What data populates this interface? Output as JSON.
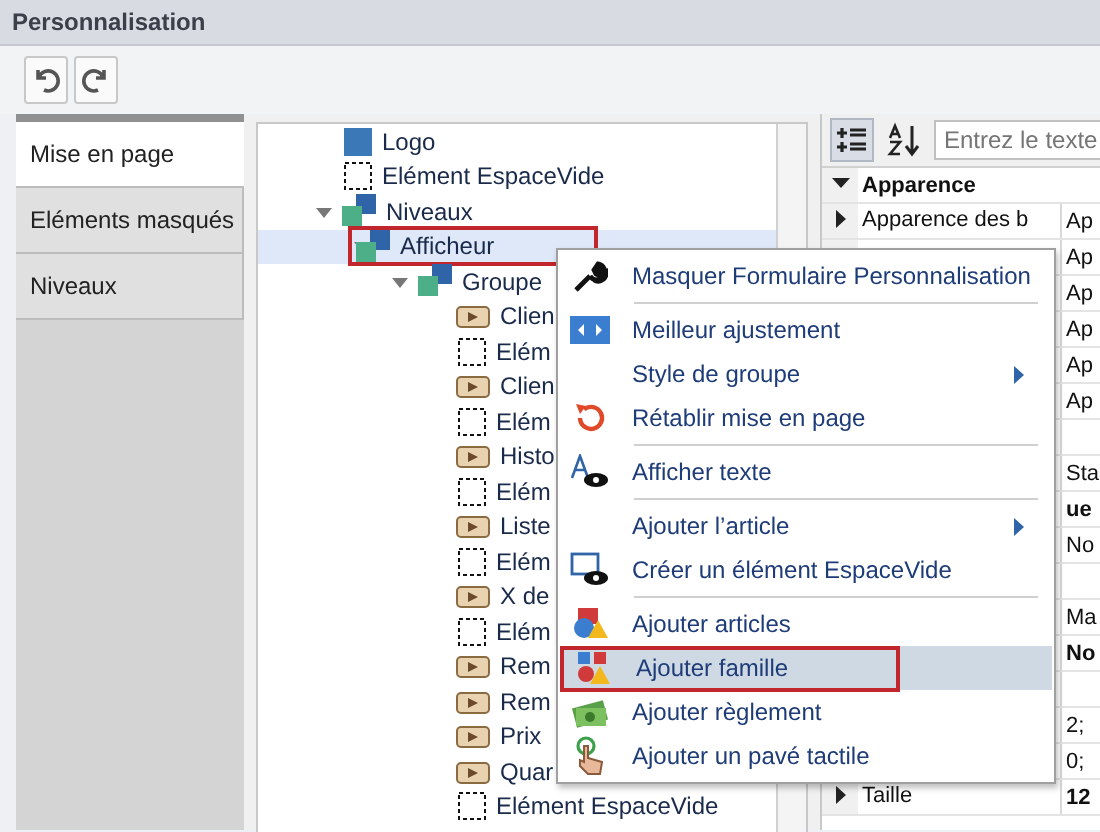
{
  "window": {
    "title": "Personnalisation"
  },
  "toolbar": {
    "buttons": [
      {
        "kind": "undo",
        "disabled": false
      },
      {
        "kind": "redo",
        "disabled": false
      }
    ]
  },
  "tabs": [
    {
      "label": "Mise en page",
      "selected": true
    },
    {
      "label": "Eléments masqués",
      "selected": false
    },
    {
      "label": "Niveaux",
      "selected": false
    }
  ],
  "tree": [
    {
      "kind": "block",
      "label": "Logo"
    },
    {
      "kind": "space",
      "label": "Elément EspaceVide"
    },
    {
      "kind": "level",
      "label": "Niveaux",
      "expanded": true,
      "children": [
        {
          "kind": "level",
          "label": "Afficheur",
          "expanded": true,
          "selected": true,
          "outlined": true,
          "children": [
            {
              "kind": "level",
              "label": "Groupe",
              "expanded": true,
              "children": [
                {
                  "kind": "item",
                  "label": "Clien"
                },
                {
                  "kind": "space",
                  "label": "Elém"
                },
                {
                  "kind": "item",
                  "label": "Clien"
                },
                {
                  "kind": "space",
                  "label": "Elém"
                },
                {
                  "kind": "item",
                  "label": "Histo"
                },
                {
                  "kind": "space",
                  "label": "Elém"
                },
                {
                  "kind": "item",
                  "label": "Liste"
                },
                {
                  "kind": "space",
                  "label": "Elém"
                },
                {
                  "kind": "item",
                  "label": "X de"
                },
                {
                  "kind": "space",
                  "label": "Elém"
                },
                {
                  "kind": "item",
                  "label": "Rem"
                },
                {
                  "kind": "item",
                  "label": "Rem"
                },
                {
                  "kind": "item",
                  "label": "Prix"
                },
                {
                  "kind": "item",
                  "label": "Quar"
                },
                {
                  "kind": "space",
                  "label": "Elément EspaceVide"
                }
              ]
            }
          ]
        }
      ]
    }
  ],
  "property_grid": {
    "search_placeholder": "Entrez le texte",
    "rows": [
      {
        "kind": "category",
        "name": "Apparence",
        "expanded": true
      },
      {
        "kind": "property",
        "name": "Apparence des b",
        "value": "Ap",
        "expanded": false
      },
      {
        "kind": "property",
        "value": "Ap"
      },
      {
        "kind": "property",
        "value": "Ap"
      },
      {
        "kind": "property",
        "value": "Ap"
      },
      {
        "kind": "property",
        "value": "Ap"
      },
      {
        "kind": "property",
        "value": "Ap"
      },
      {
        "kind": "blank"
      },
      {
        "kind": "property",
        "value": "Sta"
      },
      {
        "kind": "property",
        "value": "ue",
        "bold": true
      },
      {
        "kind": "property",
        "value": "No"
      },
      {
        "kind": "blank"
      },
      {
        "kind": "property",
        "value": "Ma"
      },
      {
        "kind": "property",
        "value": "No",
        "bold": true
      },
      {
        "kind": "blank"
      },
      {
        "kind": "property",
        "value": "2;"
      },
      {
        "kind": "property",
        "value": "0;"
      },
      {
        "kind": "property",
        "name": "Taille",
        "value": "12",
        "bold": true,
        "expanded": false
      }
    ]
  },
  "context_menu": {
    "items": [
      {
        "label": "Masquer Formulaire Personnalisation",
        "selected": false,
        "separator_after": true
      },
      {
        "label": "Meilleur ajustement",
        "selected": false
      },
      {
        "label": "Style de groupe",
        "selected": false,
        "submenu": true
      },
      {
        "label": "Rétablir mise en page",
        "selected": false,
        "separator_after": true
      },
      {
        "label": "Afficher texte",
        "selected": false,
        "separator_after": true
      },
      {
        "label": "Ajouter l’article",
        "selected": false,
        "submenu": true
      },
      {
        "label": "Créer un élément EspaceVide",
        "selected": false,
        "separator_after": true
      },
      {
        "label": "Ajouter articles",
        "selected": false
      },
      {
        "label": "Ajouter famille",
        "selected": true,
        "outlined": true
      },
      {
        "label": "Ajouter règlement",
        "selected": false
      },
      {
        "label": "Ajouter un pavé tactile",
        "selected": false
      }
    ]
  }
}
